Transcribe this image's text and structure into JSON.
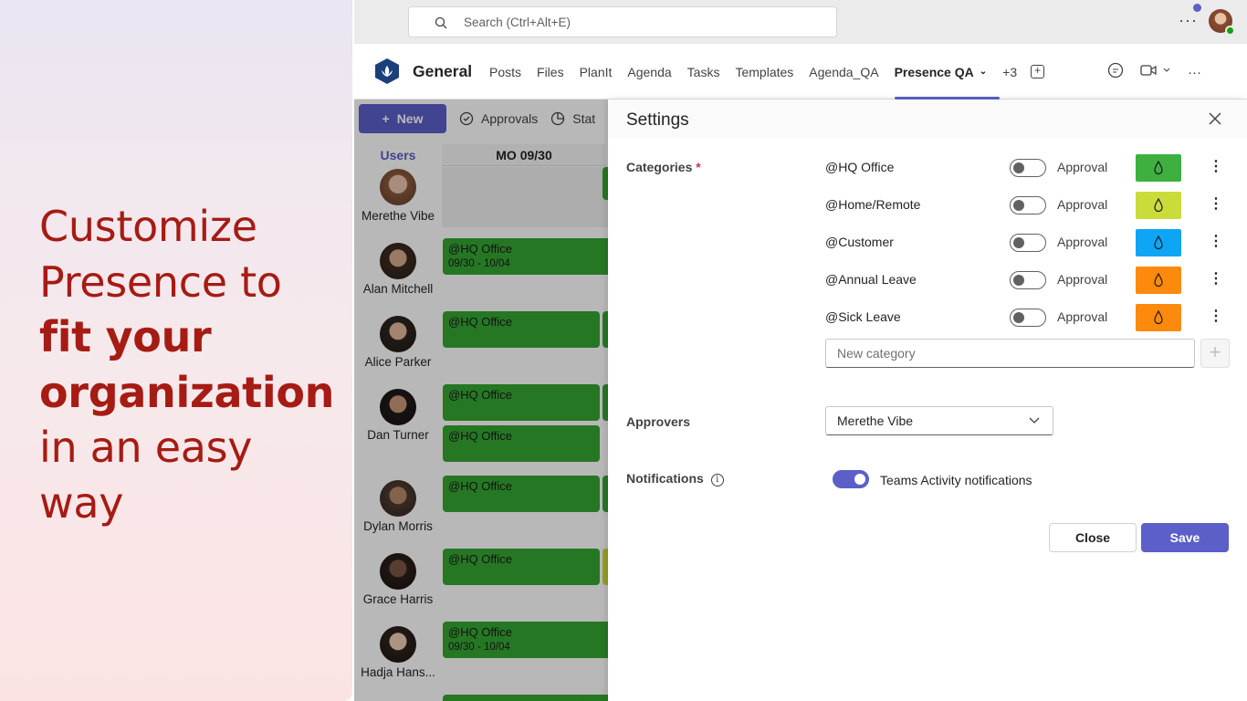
{
  "promo": {
    "line1": "Customize",
    "line2": "Presence to",
    "line3": "fit your",
    "line4": "organization",
    "line5": "in an easy",
    "line6": "way"
  },
  "topbar": {
    "search_placeholder": "Search (Ctrl+Alt+E)",
    "more": "···"
  },
  "channel": {
    "name": "General",
    "tabs": [
      "Posts",
      "Files",
      "PlanIt",
      "Agenda",
      "Tasks",
      "Templates",
      "Agenda_QA",
      "Presence QA"
    ],
    "overflow": "+3",
    "active_tab": "Presence QA"
  },
  "toolbar": {
    "new_label": "New",
    "approvals_label": "Approvals",
    "stats_label": "Stat"
  },
  "grid": {
    "users_header": "Users",
    "day_header": "MO 09/30",
    "users": [
      {
        "name": "Merethe Vibe",
        "booking": "",
        "dates": ""
      },
      {
        "name": "Alan Mitchell",
        "booking": "@HQ Office",
        "dates": "09/30 - 10/04"
      },
      {
        "name": "Alice Parker",
        "booking": "@HQ Office",
        "dates": ""
      },
      {
        "name": "Dan Turner",
        "booking": "@HQ Office",
        "booking_second": "@HQ Office",
        "dates": ""
      },
      {
        "name": "Dylan Morris",
        "booking": "@HQ Office",
        "dates": ""
      },
      {
        "name": "Grace Harris",
        "booking": "@HQ Office",
        "dates": ""
      },
      {
        "name": "Hadja Hans...",
        "booking": "@HQ Office",
        "dates": "09/30 - 10/04"
      }
    ]
  },
  "settings": {
    "title": "Settings",
    "categories_label": "Categories",
    "required_mark": "*",
    "categories": [
      {
        "name": "@HQ Office",
        "approval_label": "Approval",
        "approval_on": false,
        "color": "#3eb040"
      },
      {
        "name": "@Home/Remote",
        "approval_label": "Approval",
        "approval_on": false,
        "color": "#cadc3a"
      },
      {
        "name": "@Customer",
        "approval_label": "Approval",
        "approval_on": false,
        "color": "#0ea5f5"
      },
      {
        "name": "@Annual Leave",
        "approval_label": "Approval",
        "approval_on": false,
        "color": "#fd8a0c"
      },
      {
        "name": "@Sick Leave",
        "approval_label": "Approval",
        "approval_on": false,
        "color": "#fd8a0c"
      }
    ],
    "new_category_placeholder": "New category",
    "approvers_label": "Approvers",
    "approvers_value": "Merethe Vibe",
    "notifications_label": "Notifications",
    "notifications_text": "Teams Activity notifications",
    "notifications_on": true,
    "close_label": "Close",
    "save_label": "Save"
  },
  "colors": {
    "accent": "#5b5fc7",
    "promo_text": "#a61b13",
    "booking_green": "#35a633"
  }
}
